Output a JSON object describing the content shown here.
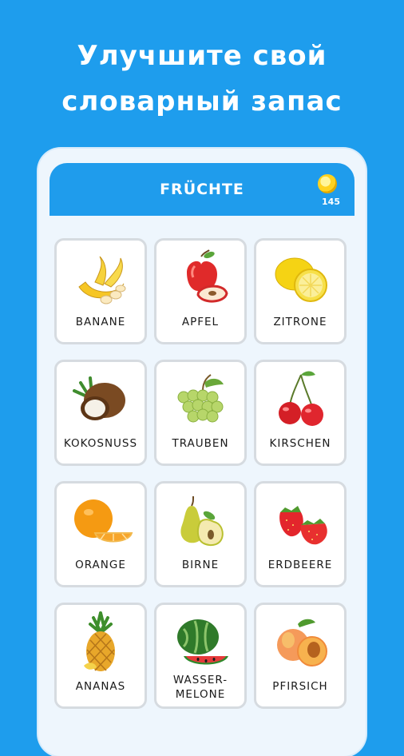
{
  "promo": {
    "line1": "Улучшите свой",
    "line2": "словарный запас"
  },
  "header": {
    "title": "FRÜCHTE",
    "coins": "145"
  },
  "cards": [
    {
      "label": "BANANE",
      "icon": "banana-icon"
    },
    {
      "label": "APFEL",
      "icon": "apple-icon"
    },
    {
      "label": "ZITRONE",
      "icon": "lemon-icon"
    },
    {
      "label": "KOKOSNUSS",
      "icon": "coconut-icon"
    },
    {
      "label": "TRAUBEN",
      "icon": "grapes-icon"
    },
    {
      "label": "KIRSCHEN",
      "icon": "cherries-icon"
    },
    {
      "label": "ORANGE",
      "icon": "orange-icon"
    },
    {
      "label": "BIRNE",
      "icon": "pear-icon"
    },
    {
      "label": "ERDBEERE",
      "icon": "strawberry-icon"
    },
    {
      "label": "ANANAS",
      "icon": "pineapple-icon"
    },
    {
      "label": "WASSER-",
      "label2": "MELONE",
      "icon": "watermelon-icon"
    },
    {
      "label": "PFIRSICH",
      "icon": "peach-icon"
    }
  ],
  "colors": {
    "background": "#1e9ded",
    "header": "#1f9cec",
    "card_border": "#d6dbe0"
  }
}
